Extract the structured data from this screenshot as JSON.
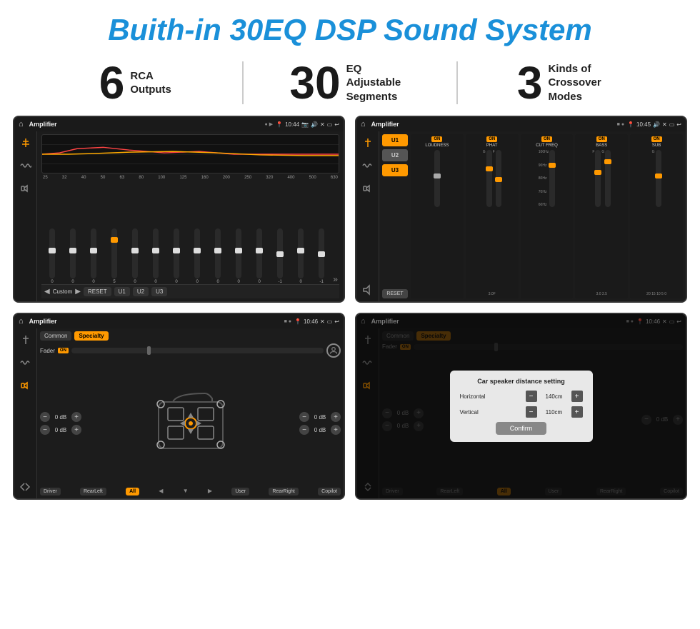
{
  "title": "Buith-in 30EQ DSP Sound System",
  "stats": [
    {
      "number": "6",
      "text": "RCA\nOutputs"
    },
    {
      "number": "30",
      "text": "EQ Adjustable\nSegments"
    },
    {
      "number": "3",
      "text": "Kinds of\nCrossover Modes"
    }
  ],
  "screens": [
    {
      "id": "eq-screen",
      "statusBar": {
        "title": "Amplifier",
        "time": "10:44"
      },
      "type": "equalizer",
      "freqs": [
        "25",
        "32",
        "40",
        "50",
        "63",
        "80",
        "100",
        "125",
        "160",
        "200",
        "250",
        "320",
        "400",
        "500",
        "630"
      ],
      "values": [
        "0",
        "0",
        "0",
        "5",
        "0",
        "0",
        "0",
        "0",
        "0",
        "0",
        "0",
        "-1",
        "0",
        "-1"
      ],
      "preset": "Custom",
      "buttons": [
        "RESET",
        "U1",
        "U2",
        "U3"
      ]
    },
    {
      "id": "crossover-screen",
      "statusBar": {
        "title": "Amplifier",
        "time": "10:45"
      },
      "type": "crossover",
      "uButtons": [
        "U1",
        "U2",
        "U3"
      ],
      "controls": [
        "LOUDNESS",
        "PHAT",
        "CUT FREQ",
        "BASS",
        "SUB"
      ],
      "resetLabel": "RESET"
    },
    {
      "id": "speaker-screen",
      "statusBar": {
        "title": "Amplifier",
        "time": "10:46"
      },
      "type": "speaker",
      "tabs": [
        "Common",
        "Specialty"
      ],
      "activeTab": "Specialty",
      "faderLabel": "Fader",
      "faderOn": "ON",
      "dbValues": [
        "0 dB",
        "0 dB",
        "0 dB",
        "0 dB"
      ],
      "bottomButtons": [
        "Driver",
        "RearLeft",
        "All",
        "User",
        "RearRight",
        "Copilot"
      ]
    },
    {
      "id": "distance-screen",
      "statusBar": {
        "title": "Amplifier",
        "time": "10:46"
      },
      "type": "distance",
      "tabs": [
        "Common",
        "Specialty"
      ],
      "activeTab": "Specialty",
      "modal": {
        "title": "Car speaker distance setting",
        "horizontal": {
          "label": "Horizontal",
          "value": "140cm"
        },
        "vertical": {
          "label": "Vertical",
          "value": "110cm"
        },
        "confirmLabel": "Confirm"
      },
      "dbValues": [
        "0 dB",
        "0 dB"
      ],
      "bottomButtons": [
        "Driver",
        "RearLeft",
        "All",
        "User",
        "RearRight",
        "Copilot"
      ]
    }
  ],
  "icons": {
    "home": "⌂",
    "back": "↩",
    "settings": "⚙",
    "equalizer": "≋",
    "waveform": "〜",
    "speaker": "🔊",
    "expand": "⤢",
    "minus": "−",
    "plus": "+"
  }
}
